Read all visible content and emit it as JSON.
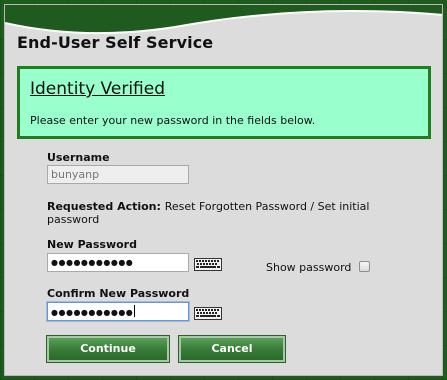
{
  "dialog": {
    "title": "End-User Self Service"
  },
  "verification": {
    "heading": "Identity Verified",
    "message": "Please enter your new password in the fields below."
  },
  "form": {
    "username_label": "Username",
    "username_value": "bunyanp",
    "requested_action_label": "Requested Action:",
    "requested_action_value": "Reset Forgotten Password / Set initial password",
    "new_password_label": "New Password",
    "new_password_masked": "●●●●●●●●●●●",
    "confirm_password_label": "Confirm New Password",
    "confirm_password_masked": "●●●●●●●●●●●",
    "show_password_label": "Show password",
    "show_password_checked": false,
    "keyboard_icon": "keyboard-icon"
  },
  "buttons": {
    "continue_label": "Continue",
    "cancel_label": "Cancel"
  },
  "colors": {
    "panel_bg": "#99ffcc",
    "panel_border": "#1f7f1f",
    "button_green": "#3b7f3b",
    "page_bg": "#1f5a1f"
  }
}
